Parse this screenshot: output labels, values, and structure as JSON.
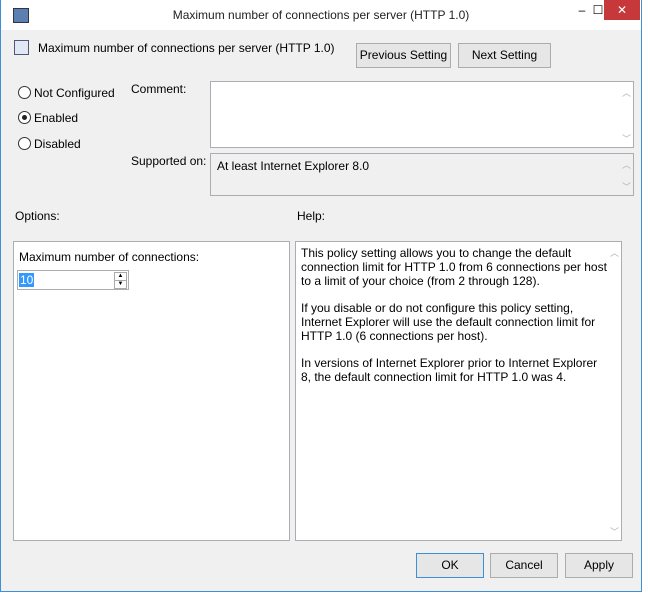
{
  "window": {
    "title": "Maximum number of connections per server (HTTP 1.0)",
    "minimize": "–",
    "maximize": "☐",
    "close": "✕"
  },
  "header": {
    "setting_name": "Maximum number of connections per server (HTTP 1.0)",
    "previous": "Previous Setting",
    "next": "Next Setting"
  },
  "state": {
    "options": [
      "Not Configured",
      "Enabled",
      "Disabled"
    ],
    "selected": "Enabled"
  },
  "comment": {
    "label": "Comment:",
    "value": ""
  },
  "supported": {
    "label": "Supported on:",
    "value": "At least Internet Explorer 8.0"
  },
  "options": {
    "label": "Options:",
    "field_label": "Maximum number of connections:",
    "value": "10"
  },
  "help": {
    "label": "Help:",
    "paragraphs": [
      "This policy setting allows you to change the default connection limit for HTTP 1.0 from 6 connections per host to a limit of your choice (from 2 through 128).",
      "If you disable or do not configure this policy setting, Internet Explorer will use the default connection limit for HTTP 1.0 (6 connections per host).",
      "In versions of Internet Explorer prior to Internet Explorer 8, the default connection limit for HTTP 1.0 was 4."
    ]
  },
  "footer": {
    "ok": "OK",
    "cancel": "Cancel",
    "apply": "Apply"
  }
}
